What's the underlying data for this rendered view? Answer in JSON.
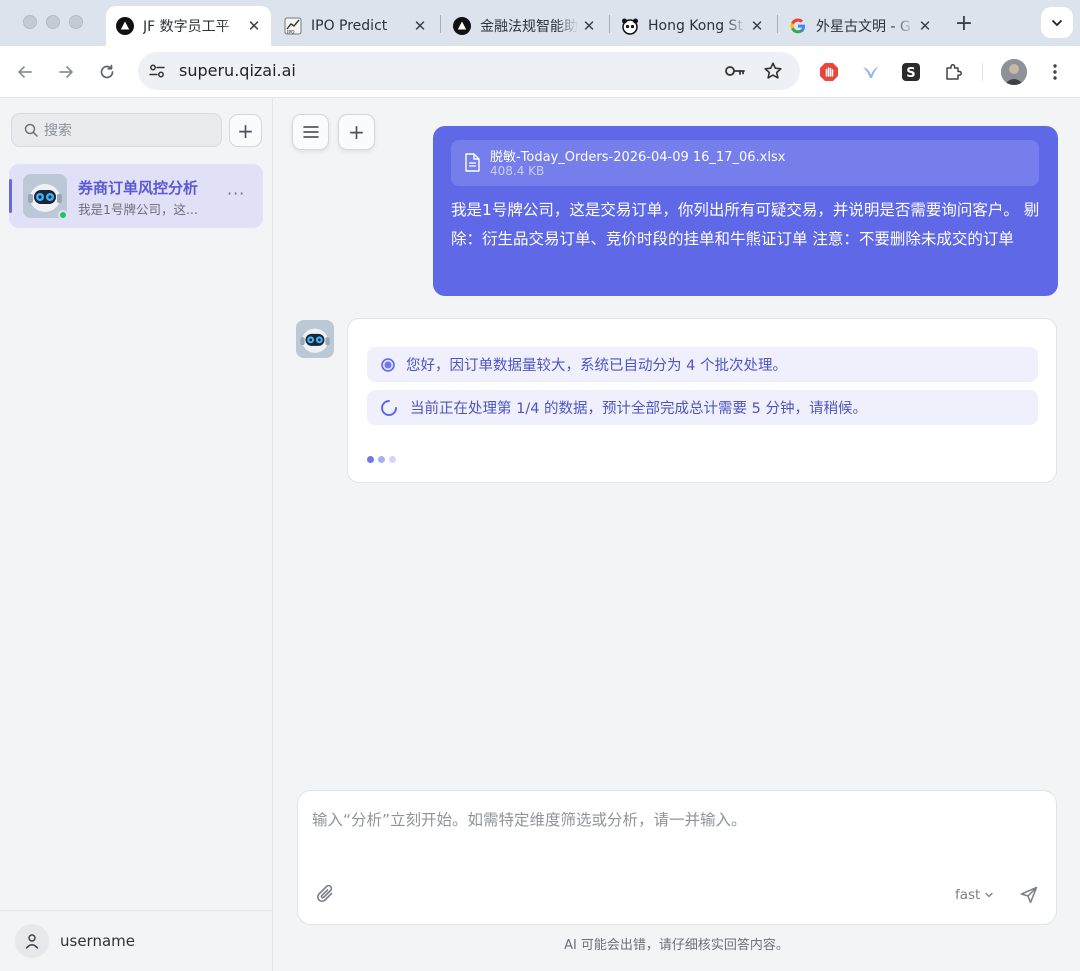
{
  "browser": {
    "tabs": [
      {
        "label": "JF 数字员工平",
        "icon": "triangle-logo-icon",
        "active": true
      },
      {
        "label": "IPO Predict",
        "icon": "ipo-logo-icon",
        "active": false
      },
      {
        "label": "金融法规智能助",
        "icon": "triangle-logo-icon",
        "active": false
      },
      {
        "label": "Hong Kong St",
        "icon": "panda-logo-icon",
        "active": false
      },
      {
        "label": "外星古文明 - G",
        "icon": "google-g-icon",
        "active": false
      }
    ],
    "tab_close": "✕",
    "new_tab": "+",
    "url": "superu.qizai.ai"
  },
  "sidebar": {
    "search_placeholder": "搜索",
    "add": "+",
    "conversations": [
      {
        "title": "券商订单风控分析",
        "preview": "我是1号牌公司，这...",
        "more": "···",
        "online": true
      }
    ],
    "username": "username"
  },
  "chat": {
    "user_message": {
      "file_name": "脱敏-Today_Orders-2026-04-09 16_17_06.xlsx",
      "file_size": "408.4 KB",
      "text": "我是1号牌公司，这是交易订单，你列出所有可疑交易，并说明是否需要询问客户。 剔除：衍生品交易订单、竞价时段的挂单和牛熊证订单 注意：不要删除未成交的订单"
    },
    "bot_message": {
      "status_1": "您好，因订单数据量较大，系统已自动分为 4 个批次处理。",
      "status_2": "当前正在处理第 1/4 的数据，预计全部完成总计需要 5 分钟，请稍候。"
    },
    "composer_placeholder": "输入“分析”立刻开始。如需特定维度筛选或分析，请一并输入。",
    "model": "fast",
    "disclaimer": "AI 可能会出错，请仔细核实回答内容。"
  },
  "colors": {
    "accent": "#5f69e8",
    "accent_text": "#5c59d6",
    "status_bg": "#eff0fb",
    "online": "#22c55e"
  }
}
